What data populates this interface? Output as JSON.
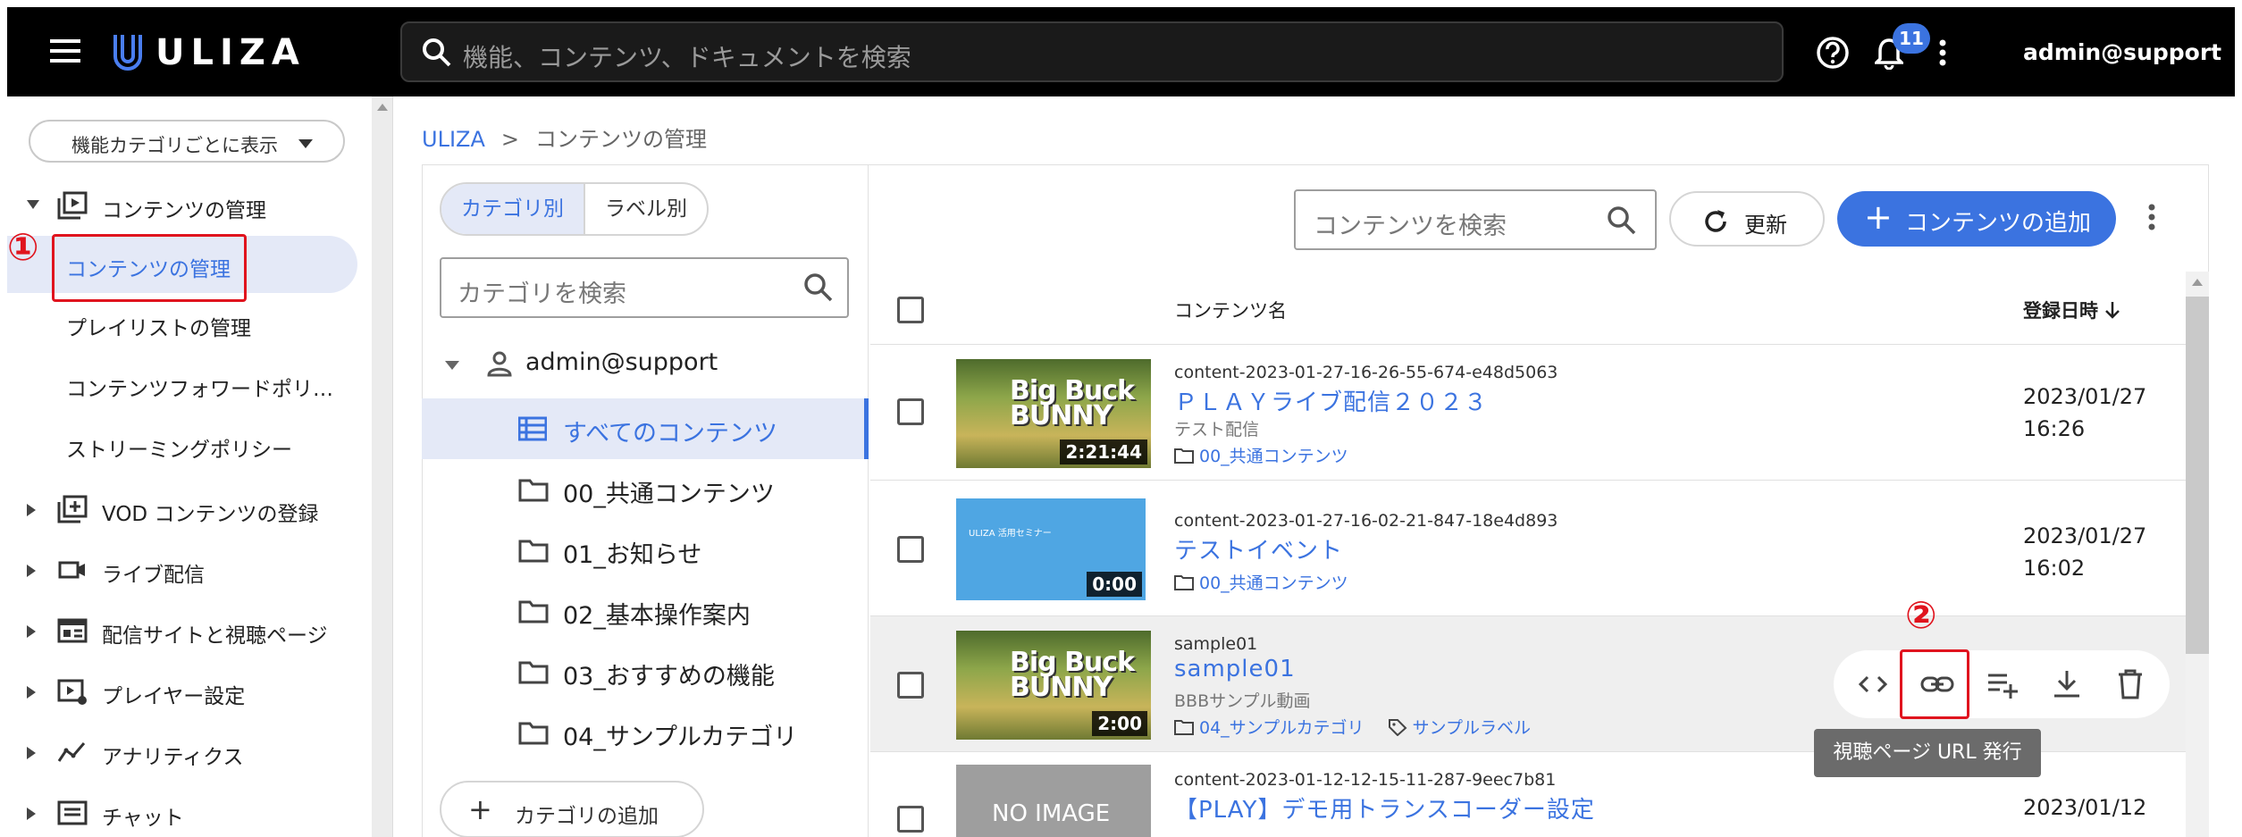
{
  "header": {
    "logo_text": "ULIZA",
    "search_placeholder": "機能、コンテンツ、ドキュメントを検索",
    "notification_count": "11",
    "user": "admin@support"
  },
  "sidebar": {
    "category_select": "機能カテゴリごとに表示",
    "groups": [
      {
        "label": "コンテンツの管理",
        "icon": "content-icon"
      },
      {
        "label": "VOD コンテンツの登録",
        "icon": "add-library-icon"
      },
      {
        "label": "ライブ配信",
        "icon": "camera-icon"
      },
      {
        "label": "配信サイトと視聴ページ",
        "icon": "web-page-icon"
      },
      {
        "label": "プレイヤー設定",
        "icon": "player-settings-icon"
      },
      {
        "label": "アナリティクス",
        "icon": "analytics-icon"
      },
      {
        "label": "チャット",
        "icon": "chat-icon"
      }
    ],
    "items": [
      {
        "label": "コンテンツの管理"
      },
      {
        "label": "プレイリストの管理"
      },
      {
        "label": "コンテンツフォワードポリ…"
      },
      {
        "label": "ストリーミングポリシー"
      }
    ]
  },
  "annotations": {
    "one": "①",
    "two": "②"
  },
  "breadcrumb": {
    "root": "ULIZA",
    "separator": ">",
    "current": "コンテンツの管理"
  },
  "category_panel": {
    "tab_category": "カテゴリ別",
    "tab_label": "ラベル別",
    "search_placeholder": "カテゴリを検索",
    "root": "admin@support",
    "items": [
      "すべてのコンテンツ",
      "00_共通コンテンツ",
      "01_お知らせ",
      "02_基本操作案内",
      "03_おすすめの機能",
      "04_サンプルカテゴリ"
    ],
    "add_button": "カテゴリの追加"
  },
  "content_panel": {
    "search_placeholder": "コンテンツを検索",
    "refresh_label": "更新",
    "add_label": "コンテンツの追加",
    "col_name": "コンテンツ名",
    "col_date": "登録日時",
    "rows": [
      {
        "thumb_text": "Big Buck BUNNY",
        "duration": "2:21:44",
        "id": "content-2023-01-27-16-26-55-674-e48d5063",
        "title": "ＰＬＡＹライブ配信２０２３",
        "desc": "テスト配信",
        "category": "00_共通コンテンツ",
        "label": "",
        "date": "2023/01/27",
        "time": "16:26"
      },
      {
        "thumb_text": "ULIZA 活用セミナー",
        "duration": "0:00",
        "id": "content-2023-01-27-16-02-21-847-18e4d893",
        "title": "テストイベント",
        "desc": "",
        "category": "00_共通コンテンツ",
        "label": "",
        "date": "2023/01/27",
        "time": "16:02"
      },
      {
        "thumb_text": "Big Buck BUNNY",
        "duration": "2:00",
        "id": "sample01",
        "title": "sample01",
        "desc": "BBBサンプル動画",
        "category": "04_サンプルカテゴリ",
        "label": "サンプルラベル",
        "date": "",
        "time": ""
      },
      {
        "thumb_text": "NO IMAGE",
        "duration": "",
        "id": "content-2023-01-12-12-15-11-287-9eec7b81",
        "title": "【PLAY】デモ用トランスコーダー設定",
        "desc": "",
        "category": "",
        "label": "",
        "date": "2023/01/12",
        "time": ""
      }
    ],
    "tooltip": "視聴ページ URL 発行"
  }
}
